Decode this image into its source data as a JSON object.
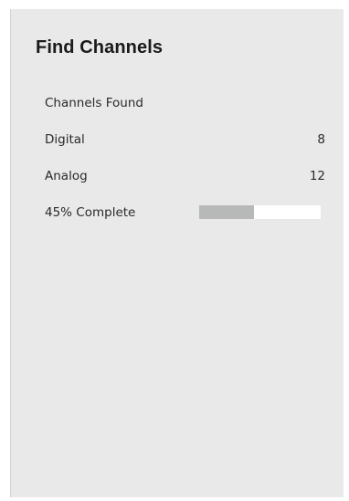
{
  "panel": {
    "title": "Find Channels"
  },
  "scan": {
    "channels_found_label": "Channels Found",
    "digital": {
      "label": "Digital",
      "count": "8"
    },
    "analog": {
      "label": "Analog",
      "count": "12"
    },
    "progress": {
      "label": "45% Complete",
      "fraction": 0.45
    }
  },
  "colors": {
    "panel_bg": "#e9e9e9",
    "progress_fill": "#b7b9b9",
    "progress_track": "#ffffff"
  }
}
